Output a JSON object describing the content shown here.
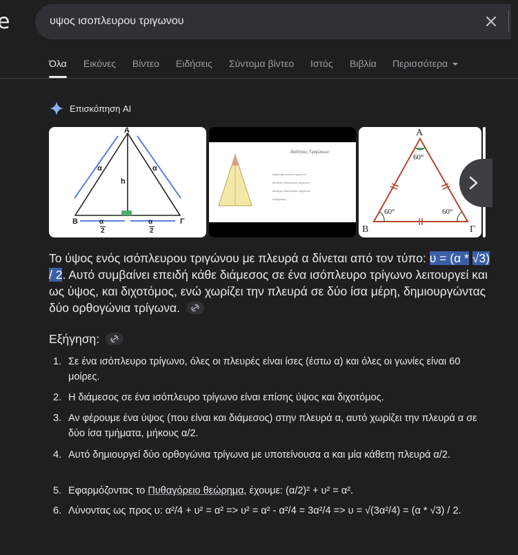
{
  "logo_fragment": "e",
  "search": {
    "query": "υψος ισοπλευρου τριγωνου",
    "clear_icon": "close-icon"
  },
  "tabs": [
    "Όλα",
    "Εικόνες",
    "Βίντεο",
    "Ειδήσεις",
    "Σύντομα βίντεο",
    "Ιστός",
    "Βιβλία",
    "Περισσότερα"
  ],
  "ai_overview": {
    "title": "Επισκόπηση AI",
    "icon": "sparkle-icon",
    "accent": "#8ab4f8"
  },
  "images": {
    "img1": {
      "apex": "Α",
      "left": "Β",
      "right": "Γ",
      "side_left": "α",
      "side_right": "α",
      "height": "h",
      "half_num": "α",
      "half_den": "2"
    },
    "img2": {
      "title": "Ιδιότητες Τριγώνων",
      "bullets": [
        "Άθροισμα γωνιών τριγώνου",
        "Ιδιότητες ισοσκελούς τριγώνου",
        "Ιδιότητες ισοπλεύρου τριγώνου",
        "Εφαρμογές"
      ]
    },
    "img3": {
      "apex": "A",
      "left": "B",
      "right": "Γ",
      "angle": "60°"
    }
  },
  "answer": {
    "before": "Το ύψος ενός ισόπλευρου τριγώνου με πλευρά α δίνεται από τον τύπο: ",
    "formula_a": "υ = (α *",
    "formula_b": "√3) / 2",
    "after": ". Αυτό συμβαίνει επειδή κάθε διάμεσος σε ένα ισόπλευρο τρίγωνο λειτουργεί και ως ύψος, και διχοτόμος, ενώ χωρίζει την πλευρά σε δύο ίσα μέρη, δημιουργώντας δύο ορθογώνια τρίγωνα."
  },
  "explanation_label": "Εξήγηση:",
  "steps": [
    {
      "n": "1.",
      "text": "Σε ένα ισόπλευρο τρίγωνο, όλες οι πλευρές είναι ίσες (έστω α) και όλες οι γωνίες είναι 60 μοίρες."
    },
    {
      "n": "2.",
      "text": "Η διάμεσος σε ένα ισόπλευρο τρίγωνο είναι επίσης ύψος και διχοτόμος."
    },
    {
      "n": "3.",
      "text": "Αν φέρουμε ένα ύψος (που είναι και διάμεσος) στην πλευρά α, αυτό χωρίζει την πλευρά α σε δύο ίσα τμήματα, μήκους α/2."
    },
    {
      "n": "4.",
      "text": "Αυτό δημιουργεί δύο ορθογώνια τρίγωνα με υποτείνουσα α και μία κάθετη πλευρά α/2."
    },
    {
      "n": "5.",
      "pre": "Εφαρμόζοντας το ",
      "link": "Πυθαγόρειο θεώρημα",
      "post": ", έχουμε: (α/2)² + υ² = α²."
    },
    {
      "n": "6.",
      "text": "Λύνοντας ως προς υ: α²/4 + υ² = α² => υ² = α² - α²/4 = 3α²/4 => υ = √(3α²/4) = (α * √3) / 2."
    }
  ]
}
